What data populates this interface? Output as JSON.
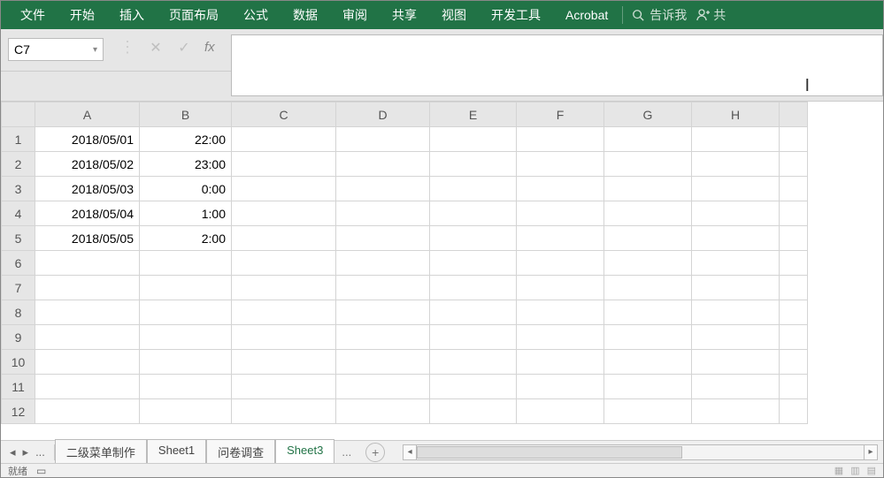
{
  "ribbon": {
    "tabs": [
      "文件",
      "开始",
      "插入",
      "页面布局",
      "公式",
      "数据",
      "审阅",
      "共享",
      "视图",
      "开发工具",
      "Acrobat"
    ],
    "tell_me": "告诉我",
    "share": "共"
  },
  "formula_bar": {
    "name_box": "C7",
    "formula": ""
  },
  "columns": [
    "A",
    "B",
    "C",
    "D",
    "E",
    "F",
    "G",
    "H"
  ],
  "rows": [
    {
      "n": "1",
      "A": "2018/05/01",
      "B": "22:00"
    },
    {
      "n": "2",
      "A": "2018/05/02",
      "B": "23:00"
    },
    {
      "n": "3",
      "A": "2018/05/03",
      "B": "0:00"
    },
    {
      "n": "4",
      "A": "2018/05/04",
      "B": "1:00"
    },
    {
      "n": "5",
      "A": "2018/05/05",
      "B": "2:00"
    },
    {
      "n": "6"
    },
    {
      "n": "7"
    },
    {
      "n": "8"
    },
    {
      "n": "9"
    },
    {
      "n": "10"
    },
    {
      "n": "11"
    },
    {
      "n": "12"
    }
  ],
  "sheet_tabs": {
    "items": [
      "二级菜单制作",
      "Sheet1",
      "问卷调查",
      "Sheet3"
    ],
    "active": "Sheet3",
    "ellipsis": "...",
    "nav_prev": "◂",
    "nav_next": "▸"
  },
  "status": {
    "ready": "就绪"
  }
}
